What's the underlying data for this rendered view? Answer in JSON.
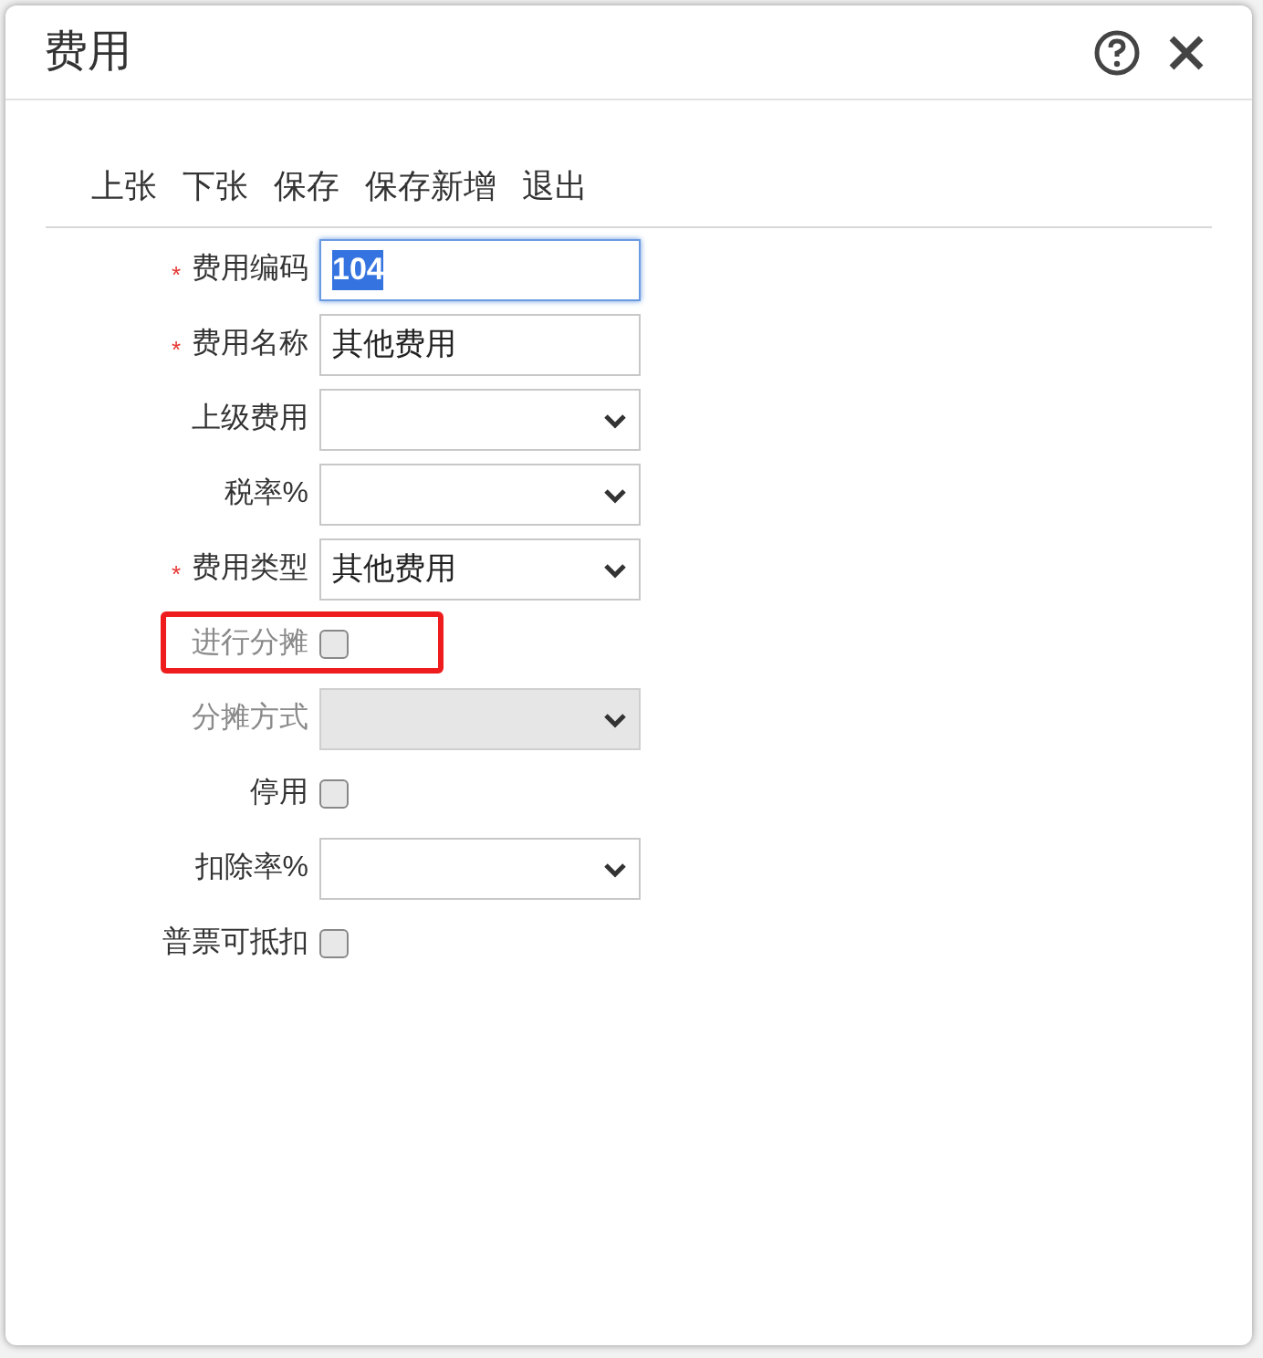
{
  "window": {
    "title": "费用"
  },
  "toolbar": [
    "上张",
    "下张",
    "保存",
    "保存新增",
    "退出"
  ],
  "fields": [
    {
      "kind": "text",
      "label": "费用编码",
      "marker": "*",
      "value": "104",
      "selected": true
    },
    {
      "kind": "text",
      "label": "费用名称",
      "marker": "*",
      "value": "其他费用",
      "selected": false
    },
    {
      "kind": "select",
      "label": "上级费用",
      "disabled": false
    },
    {
      "kind": "select",
      "label": "税率%",
      "disabled": false
    },
    {
      "kind": "select",
      "label": "费用类型",
      "marker": "*",
      "value": "其他费用",
      "disabled": false
    },
    {
      "kind": "checkbox",
      "label": "进行分摊",
      "checked": false,
      "disabled": true,
      "highlighted": true
    },
    {
      "kind": "select",
      "label": "分摊方式",
      "disabled": true
    },
    {
      "kind": "checkbox",
      "label": "停用",
      "checked": false,
      "disabled": false,
      "highlighted": false
    },
    {
      "kind": "select",
      "label": "扣除率%",
      "disabled": false
    },
    {
      "kind": "checkbox",
      "label": "普票可抵扣",
      "checked": false,
      "disabled": false,
      "highlighted": false
    }
  ]
}
